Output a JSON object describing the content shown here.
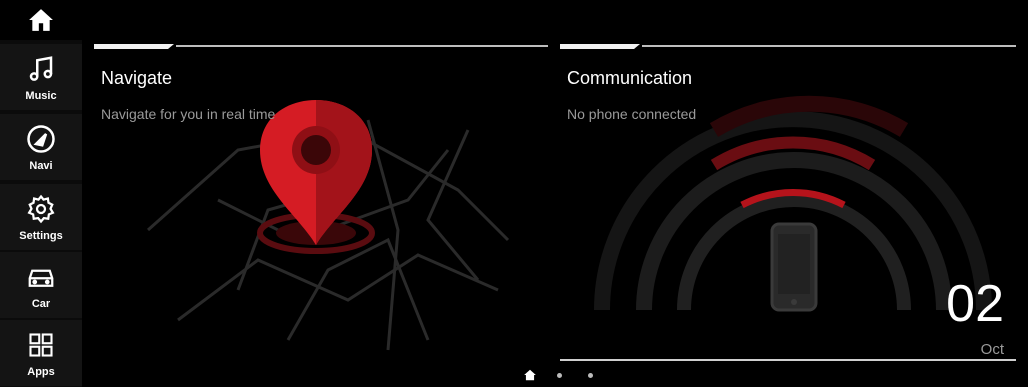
{
  "sidebar": {
    "items": [
      {
        "key": "home",
        "label": "",
        "icon": "home-icon"
      },
      {
        "key": "music",
        "label": "Music",
        "icon": "music-note-icon"
      },
      {
        "key": "navi",
        "label": "Navi",
        "icon": "compass-icon"
      },
      {
        "key": "settings",
        "label": "Settings",
        "icon": "gear-icon"
      },
      {
        "key": "car",
        "label": "Car",
        "icon": "car-icon"
      },
      {
        "key": "apps",
        "label": "Apps",
        "icon": "apps-grid-icon"
      }
    ]
  },
  "navigate_card": {
    "title": "Navigate",
    "subtitle": "Navigate for you in real time"
  },
  "communication_card": {
    "title": "Communication",
    "subtitle": "No phone connected"
  },
  "date": {
    "day": "02",
    "month": "Oct"
  },
  "pager": {
    "active_icon": "home-icon",
    "page_count": 3,
    "active_index": 0
  },
  "colors": {
    "accent": "#c0121b",
    "background": "#000000",
    "sidebar": "#141414",
    "muted_text": "#9a9a9a"
  }
}
